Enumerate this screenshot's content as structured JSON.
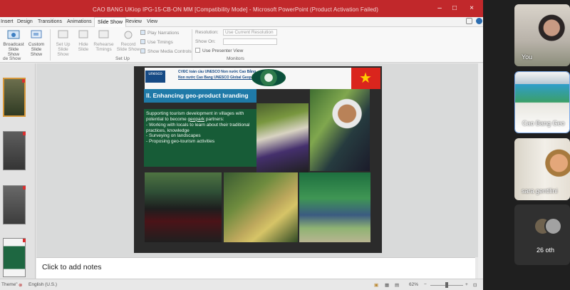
{
  "app": {
    "window_title": "CAO BANG UKiop IPG-15-CB-ON MM [Compatibility Mode] - Microsoft PowerPoint (Product Activation Failed)",
    "tabs": [
      "Insert",
      "Design",
      "Transitions",
      "Animations",
      "Slide Show",
      "Review",
      "View"
    ]
  },
  "ribbon": {
    "broadcast": "Broadcast Slide Show",
    "custom": "Custom Slide Show",
    "set_up": "Set Up Slide Show",
    "hide": "Hide Slide",
    "rehearse": "Rehearse Timings",
    "record": "Record Slide Show",
    "play_narrations": "Play Narrations",
    "use_timings": "Use Timings",
    "show_media_controls": "Show Media Controls",
    "resolution_label": "Resolution:",
    "resolution_value": "Use Current Resolution",
    "show_on_label": "Show On:",
    "presenter_view": "Use Presenter View",
    "groups": {
      "slide_show": "de Show",
      "set_up": "Set Up",
      "monitors": "Monitors"
    }
  },
  "slide": {
    "unesco": "unesco",
    "head_line_1": "CVĐC toàn cầu UNESCO  Non nước  Cao Bằng",
    "head_line_2": "Non nước  Cao Bang UNESCO  Global  Geopark",
    "heading": "II. Enhancing geo-product branding",
    "content_intro": "Supporting tourism development in villages with potential to become",
    "content_underlined": "geopark",
    "content_intro_end": "partners:",
    "bullets": [
      "Working with locals to learn about their traditional practices, knowledge",
      "Surveying on landscapes",
      "Proposing geo-tourism activities"
    ]
  },
  "editor": {
    "notes_placeholder": "Click to add notes"
  },
  "status": {
    "theme": "Theme\"",
    "language": "English (U.S.)",
    "zoom": "62%"
  },
  "participants": [
    {
      "name": "You"
    },
    {
      "name": "Cao Bang Geo"
    },
    {
      "name": "sara gentilini"
    }
  ],
  "others": {
    "count_label": "26 oth"
  }
}
